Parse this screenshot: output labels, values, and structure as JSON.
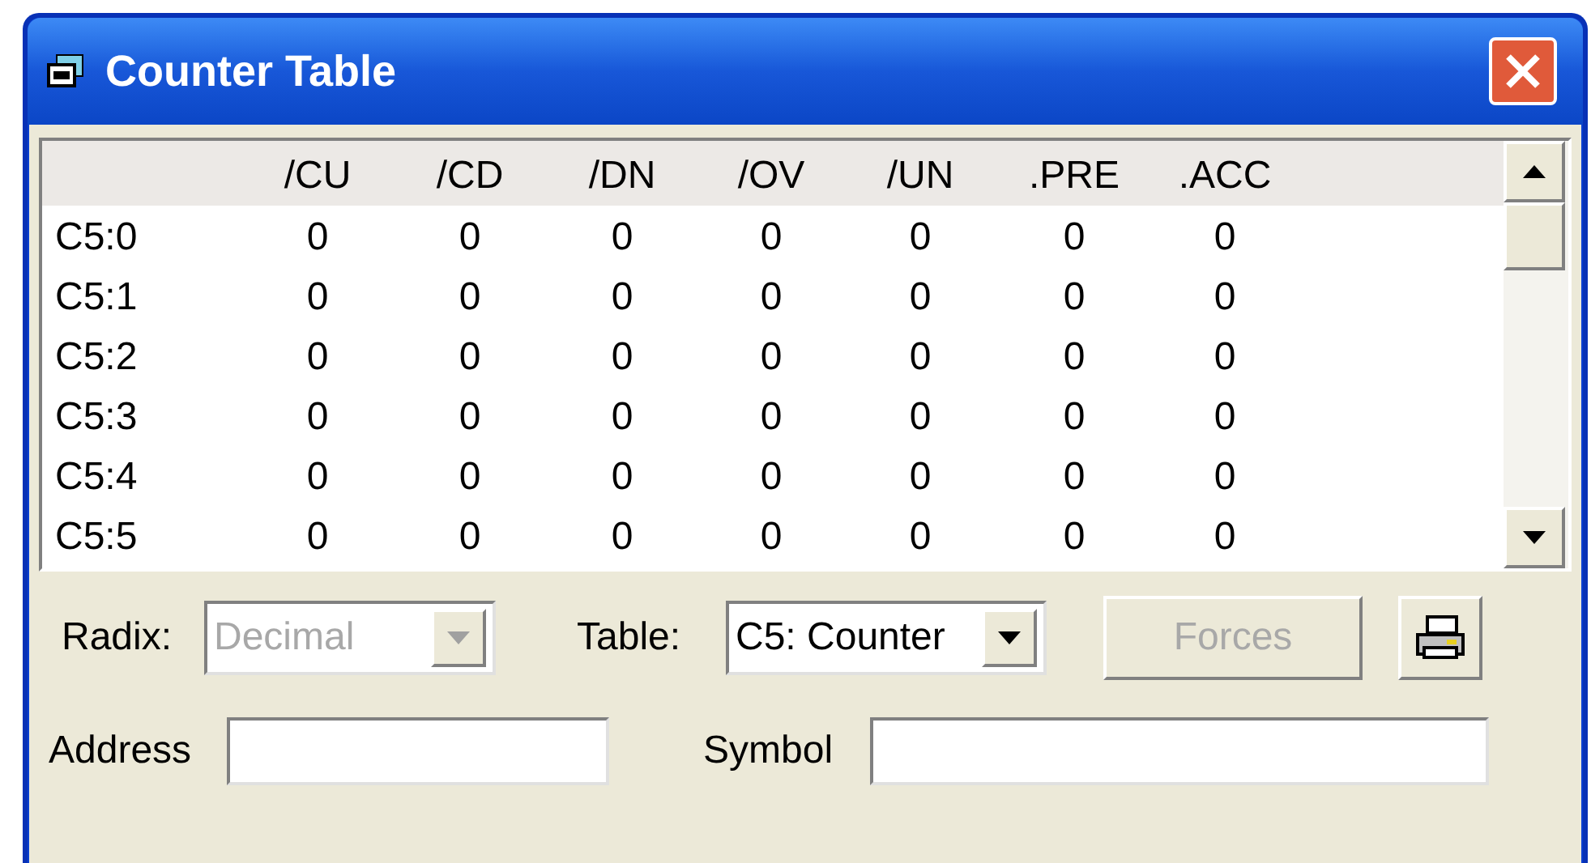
{
  "window": {
    "title": "Counter Table"
  },
  "table": {
    "columns": [
      "/CU",
      "/CD",
      "/DN",
      "/OV",
      "/UN",
      ".PRE",
      ".ACC"
    ],
    "rows": [
      {
        "address": "C5:0",
        "values": [
          "0",
          "0",
          "0",
          "0",
          "0",
          "0",
          "0"
        ]
      },
      {
        "address": "C5:1",
        "values": [
          "0",
          "0",
          "0",
          "0",
          "0",
          "0",
          "0"
        ]
      },
      {
        "address": "C5:2",
        "values": [
          "0",
          "0",
          "0",
          "0",
          "0",
          "0",
          "0"
        ]
      },
      {
        "address": "C5:3",
        "values": [
          "0",
          "0",
          "0",
          "0",
          "0",
          "0",
          "0"
        ]
      },
      {
        "address": "C5:4",
        "values": [
          "0",
          "0",
          "0",
          "0",
          "0",
          "0",
          "0"
        ]
      },
      {
        "address": "C5:5",
        "values": [
          "0",
          "0",
          "0",
          "0",
          "0",
          "0",
          "0"
        ]
      }
    ]
  },
  "radix": {
    "label": "Radix:",
    "value": "Decimal",
    "disabled": true
  },
  "table_select": {
    "label": "Table:",
    "value": "C5: Counter",
    "disabled": false
  },
  "forces_button": {
    "label": "Forces",
    "disabled": true
  },
  "address_field": {
    "label": "Address"
  },
  "symbol_field": {
    "label": "Symbol"
  }
}
